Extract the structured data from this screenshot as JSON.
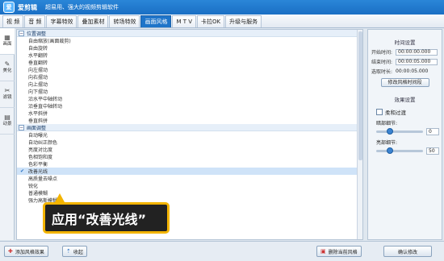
{
  "app": {
    "logo_glyph": "爱",
    "name": "爱剪辑",
    "slogan": "超易用、强大的视频剪辑软件"
  },
  "menu": {
    "tabs": [
      "视 频",
      "音 频",
      "字幕特效",
      "叠加素材",
      "转场特效",
      "画面风格",
      "M T V",
      "卡拉OK",
      "升级与服务"
    ],
    "active_index": 5
  },
  "sidebar": {
    "items": [
      {
        "icon": "▦",
        "label": "画面"
      },
      {
        "icon": "✎",
        "label": "美化"
      },
      {
        "icon": "✂",
        "label": "滤镜"
      },
      {
        "icon": "▤",
        "label": "动景"
      }
    ]
  },
  "list": {
    "groups": [
      {
        "title": "位置调整",
        "items": [
          "自由缩放(画面裁剪)",
          "自由旋转",
          "水平翻转",
          "垂直翻转",
          "向左摆动",
          "向右摆动",
          "向上摆动",
          "向下摆动",
          "沿水平中轴转动",
          "沿垂直中轴转动",
          "水平斜拼",
          "垂直斜拼"
        ]
      },
      {
        "title": "画面调整",
        "items": [
          "自动曝光",
          "自动纠正颜色",
          "亮度对比度",
          "色相饱和度",
          "色彩平衡",
          "改善光线",
          "高质量去噪点",
          "锐化",
          "普通模糊",
          "强力高斯模糊"
        ]
      }
    ],
    "selected_item": "改善光线",
    "checkmark": "✔"
  },
  "callout": {
    "text": "应用“改善光线”"
  },
  "time_settings": {
    "title": "时间设置",
    "start_label": "开始时间:",
    "start_value": "00:00:00.000",
    "end_label": "结束时间:",
    "end_value": "00:00:05.000",
    "duration_label": "选取时长:",
    "duration_value": "00:00:05.000",
    "button_label": "修改风格时间段"
  },
  "effect_settings": {
    "title": "效果设置",
    "checkbox_label": "柔和过渡",
    "dark_label": "暗部细节:",
    "dark_value": "0",
    "dark_level": 0.3,
    "bright_label": "亮部细节:",
    "bright_value": "50",
    "bright_level": 0.3
  },
  "bottom": {
    "add_label": "添加风格效果",
    "collapse_label": "收起",
    "delete_label": "删除当前风格",
    "confirm_label": "确认修改"
  },
  "colors": {
    "accent": "#1e74c9",
    "callout_border": "#f3b400",
    "selected_row": "#cfe3f8"
  }
}
